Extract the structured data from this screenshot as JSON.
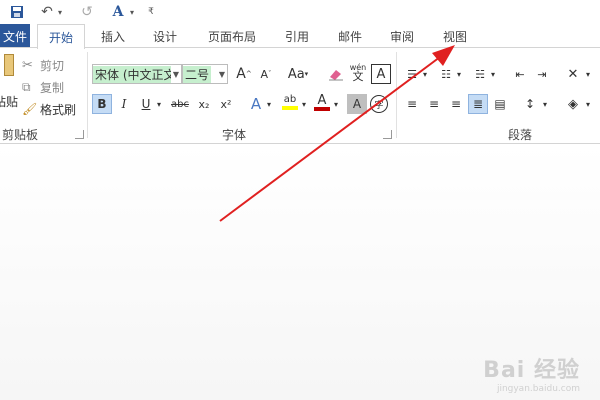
{
  "quick_access": {
    "icons": [
      "save-icon",
      "undo-icon",
      "redo-icon",
      "text-style-icon",
      "customize-qat-icon"
    ]
  },
  "tabs": {
    "file": "文件",
    "items": [
      "开始",
      "插入",
      "设计",
      "页面布局",
      "引用",
      "邮件",
      "审阅",
      "视图"
    ],
    "active": "开始"
  },
  "clipboard": {
    "paste": "粘贴",
    "cut": "剪切",
    "copy": "复制",
    "format_painter": "格式刷",
    "label": "剪贴板"
  },
  "font": {
    "name": "宋体 (中文正文)",
    "size": "二号",
    "grow": "A",
    "shrink": "A",
    "case": "Aa",
    "phonetic_top": "wén",
    "phonetic_bottom": "文",
    "border_char": "A",
    "bold": "B",
    "italic": "I",
    "underline": "U",
    "strike": "abc",
    "subscript": "x₂",
    "superscript": "x²",
    "effects": "A",
    "highlight": "ab",
    "color": "A",
    "shading": "A",
    "enclose": "字",
    "label": "字体"
  },
  "paragraph": {
    "label": "段落"
  },
  "colors": {
    "file_tab": "#2b579a",
    "highlight": "#ffff00",
    "font_color": "#c00000",
    "arrow": "#e02020"
  },
  "watermark": {
    "main": "Bai 经验",
    "sub": "jingyan.baidu.com"
  }
}
